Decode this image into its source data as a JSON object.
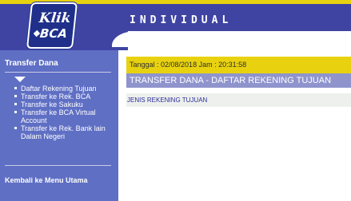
{
  "header": {
    "title": "INDIVIDUAL",
    "logo_top": "Klik",
    "logo_bottom": "BCA"
  },
  "sidebar": {
    "heading": "Transfer Dana",
    "items": [
      {
        "label": "Daftar Rekening Tujuan"
      },
      {
        "label": "Transfer ke Rek. BCA"
      },
      {
        "label": "Transfer ke Sakuku"
      },
      {
        "label": "Transfer ke BCA Virtual Account"
      },
      {
        "label": "Transfer ke Rek. Bank lain Dalam Negeri"
      }
    ],
    "back_link": "Kembali ke Menu Utama"
  },
  "main": {
    "datetime_text": "Tanggal : 02/08/2018 Jam : 20:31:58",
    "page_title": "TRANSFER DANA - DAFTAR REKENING TUJUAN",
    "section_label": "JENIS REKENING TUJUAN"
  },
  "colors": {
    "header_blue": "#3f44a3",
    "sidebar_blue": "#5f6fc4",
    "accent_yellow": "#e8d210",
    "title_bar": "#8f94cd"
  }
}
